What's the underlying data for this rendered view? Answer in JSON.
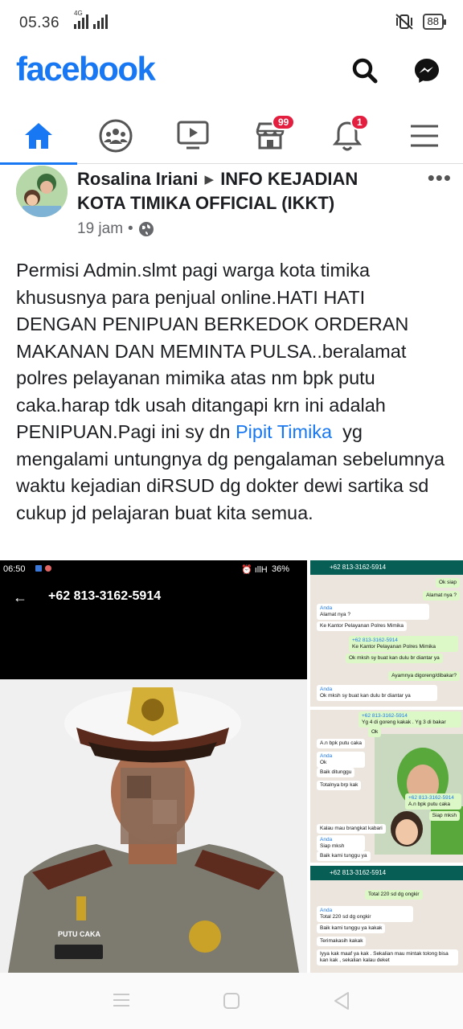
{
  "status": {
    "time": "05.36",
    "network": "4G",
    "battery": "88"
  },
  "header": {
    "logo": "facebook",
    "icons": [
      "search-icon",
      "messenger-icon"
    ]
  },
  "nav": {
    "items": [
      {
        "icon": "home-icon",
        "active": true
      },
      {
        "icon": "groups-icon"
      },
      {
        "icon": "watch-icon"
      },
      {
        "icon": "marketplace-icon",
        "badge": "99"
      },
      {
        "icon": "notifications-icon",
        "badge": "1"
      },
      {
        "icon": "menu-icon"
      }
    ]
  },
  "post": {
    "author": "Rosalina Iriani",
    "group": "INFO KEJADIAN KOTA TIMIKA OFFICIAL (IKKT)",
    "time": "19 jam",
    "more": "•••",
    "text_before": "Permisi Admin.slmt pagi warga kota timika khususnya para penjual online.HATI HATI DENGAN PENIPUAN BERKEDOK ORDERAN MAKANAN DAN MEMINTA PULSA..beralamat polres pelayanan mimika atas nm bpk putu caka.harap tdk usah ditangapi krn ini adalah PENIPUAN.Pagi ini sy dn ",
    "mention": "Pipit Timika",
    "text_after": "  yg mengalami untungnya dg pengalaman sebelumnya waktu kejadian diRSUD dg dokter dewi sartika sd cukup jd pelajaran buat kita semua."
  },
  "media": {
    "left": {
      "time": "06:50",
      "battery": "36%",
      "number": "+62 813-3162-5914",
      "name_tag": "PUTU CAKA"
    },
    "chat1": {
      "number": "+62 813-3162-5914",
      "messages": [
        {
          "from": "out",
          "text": "Ok siap"
        },
        {
          "from": "out",
          "text": "Alamat nya ?"
        },
        {
          "from": "in",
          "name": "Anda",
          "text": "Alamat nya ?"
        },
        {
          "from": "in",
          "text": "Ke Kantor Pelayanan Polres Mimika"
        },
        {
          "from": "out",
          "name": "+62 813-3162-5914",
          "text": "Ke Kantor Pelayanan Polres Mimika"
        },
        {
          "from": "out",
          "text": "Ok mksh sy buat kan dulu br diantar ya"
        },
        {
          "from": "out",
          "text": "Ayamnya digoreng/dibakar?"
        },
        {
          "from": "in",
          "name": "Anda",
          "text": "Ok mksh sy buat kan dulu br diantar ya"
        }
      ]
    },
    "chat2": {
      "messages": [
        {
          "from": "out",
          "name": "+62 813-3162-5914",
          "text": "Yg 4 di goreng kakak . Yg 3 di bakar"
        },
        {
          "from": "out",
          "text": "Ok"
        },
        {
          "from": "in",
          "text": "A.n bpk putu caka"
        },
        {
          "from": "in",
          "name": "Anda",
          "text": "Ok"
        },
        {
          "from": "in",
          "text": "Baik ditunggu"
        },
        {
          "from": "in",
          "text": "Totalnya brp kak"
        },
        {
          "from": "out",
          "name": "+62 813-3162-5914",
          "text": "A.n bpk putu caka"
        },
        {
          "from": "out",
          "text": "Siap mksh"
        },
        {
          "from": "in",
          "text": "Kalau mau brangkat kabari"
        },
        {
          "from": "in",
          "name": "Anda",
          "text": "Siap mksh"
        },
        {
          "from": "in",
          "text": "Baik kami tunggu ya"
        }
      ]
    },
    "chat3": {
      "number": "+62 813-3162-5914",
      "messages": [
        {
          "from": "out",
          "text": "Total 220 sd dg ongkir"
        },
        {
          "from": "in",
          "name": "Anda",
          "text": "Total 220 sd dg ongkir"
        },
        {
          "from": "in",
          "text": "Baik kami tunggu ya kakak"
        },
        {
          "from": "in",
          "text": "Terimakasih kakak"
        },
        {
          "from": "in",
          "text": "Iyya kak maaf ya kak . Sekalian mau mintak tolong bisa kan kak , sekalian kalau deket"
        }
      ]
    }
  },
  "colors": {
    "brand": "#1877f2",
    "badge": "#e41e3f",
    "whatsapp": "#075e54"
  }
}
